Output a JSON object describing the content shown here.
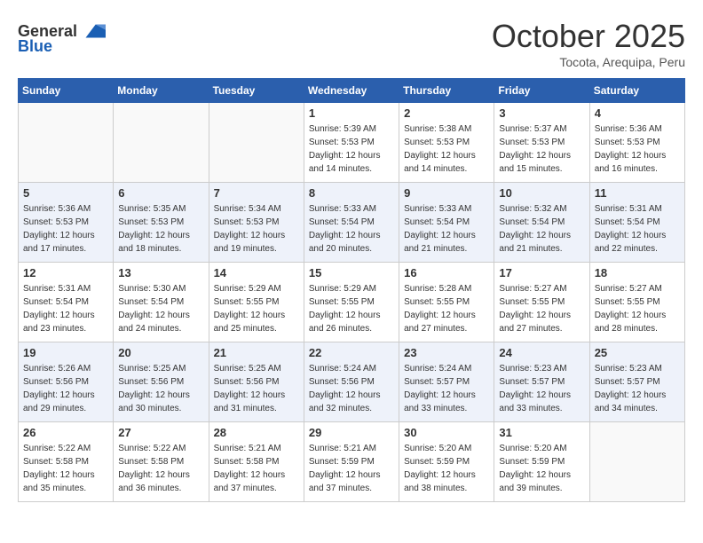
{
  "header": {
    "logo_general": "General",
    "logo_blue": "Blue",
    "month": "October 2025",
    "location": "Tocota, Arequipa, Peru"
  },
  "weekdays": [
    "Sunday",
    "Monday",
    "Tuesday",
    "Wednesday",
    "Thursday",
    "Friday",
    "Saturday"
  ],
  "weeks": [
    [
      {
        "day": "",
        "empty": true
      },
      {
        "day": "",
        "empty": true
      },
      {
        "day": "",
        "empty": true
      },
      {
        "day": "1",
        "sunrise": "5:39 AM",
        "sunset": "5:53 PM",
        "daylight": "12 hours and 14 minutes."
      },
      {
        "day": "2",
        "sunrise": "5:38 AM",
        "sunset": "5:53 PM",
        "daylight": "12 hours and 14 minutes."
      },
      {
        "day": "3",
        "sunrise": "5:37 AM",
        "sunset": "5:53 PM",
        "daylight": "12 hours and 15 minutes."
      },
      {
        "day": "4",
        "sunrise": "5:36 AM",
        "sunset": "5:53 PM",
        "daylight": "12 hours and 16 minutes."
      }
    ],
    [
      {
        "day": "5",
        "sunrise": "5:36 AM",
        "sunset": "5:53 PM",
        "daylight": "12 hours and 17 minutes."
      },
      {
        "day": "6",
        "sunrise": "5:35 AM",
        "sunset": "5:53 PM",
        "daylight": "12 hours and 18 minutes."
      },
      {
        "day": "7",
        "sunrise": "5:34 AM",
        "sunset": "5:53 PM",
        "daylight": "12 hours and 19 minutes."
      },
      {
        "day": "8",
        "sunrise": "5:33 AM",
        "sunset": "5:54 PM",
        "daylight": "12 hours and 20 minutes."
      },
      {
        "day": "9",
        "sunrise": "5:33 AM",
        "sunset": "5:54 PM",
        "daylight": "12 hours and 21 minutes."
      },
      {
        "day": "10",
        "sunrise": "5:32 AM",
        "sunset": "5:54 PM",
        "daylight": "12 hours and 21 minutes."
      },
      {
        "day": "11",
        "sunrise": "5:31 AM",
        "sunset": "5:54 PM",
        "daylight": "12 hours and 22 minutes."
      }
    ],
    [
      {
        "day": "12",
        "sunrise": "5:31 AM",
        "sunset": "5:54 PM",
        "daylight": "12 hours and 23 minutes."
      },
      {
        "day": "13",
        "sunrise": "5:30 AM",
        "sunset": "5:54 PM",
        "daylight": "12 hours and 24 minutes."
      },
      {
        "day": "14",
        "sunrise": "5:29 AM",
        "sunset": "5:55 PM",
        "daylight": "12 hours and 25 minutes."
      },
      {
        "day": "15",
        "sunrise": "5:29 AM",
        "sunset": "5:55 PM",
        "daylight": "12 hours and 26 minutes."
      },
      {
        "day": "16",
        "sunrise": "5:28 AM",
        "sunset": "5:55 PM",
        "daylight": "12 hours and 27 minutes."
      },
      {
        "day": "17",
        "sunrise": "5:27 AM",
        "sunset": "5:55 PM",
        "daylight": "12 hours and 27 minutes."
      },
      {
        "day": "18",
        "sunrise": "5:27 AM",
        "sunset": "5:55 PM",
        "daylight": "12 hours and 28 minutes."
      }
    ],
    [
      {
        "day": "19",
        "sunrise": "5:26 AM",
        "sunset": "5:56 PM",
        "daylight": "12 hours and 29 minutes."
      },
      {
        "day": "20",
        "sunrise": "5:25 AM",
        "sunset": "5:56 PM",
        "daylight": "12 hours and 30 minutes."
      },
      {
        "day": "21",
        "sunrise": "5:25 AM",
        "sunset": "5:56 PM",
        "daylight": "12 hours and 31 minutes."
      },
      {
        "day": "22",
        "sunrise": "5:24 AM",
        "sunset": "5:56 PM",
        "daylight": "12 hours and 32 minutes."
      },
      {
        "day": "23",
        "sunrise": "5:24 AM",
        "sunset": "5:57 PM",
        "daylight": "12 hours and 33 minutes."
      },
      {
        "day": "24",
        "sunrise": "5:23 AM",
        "sunset": "5:57 PM",
        "daylight": "12 hours and 33 minutes."
      },
      {
        "day": "25",
        "sunrise": "5:23 AM",
        "sunset": "5:57 PM",
        "daylight": "12 hours and 34 minutes."
      }
    ],
    [
      {
        "day": "26",
        "sunrise": "5:22 AM",
        "sunset": "5:58 PM",
        "daylight": "12 hours and 35 minutes."
      },
      {
        "day": "27",
        "sunrise": "5:22 AM",
        "sunset": "5:58 PM",
        "daylight": "12 hours and 36 minutes."
      },
      {
        "day": "28",
        "sunrise": "5:21 AM",
        "sunset": "5:58 PM",
        "daylight": "12 hours and 37 minutes."
      },
      {
        "day": "29",
        "sunrise": "5:21 AM",
        "sunset": "5:59 PM",
        "daylight": "12 hours and 37 minutes."
      },
      {
        "day": "30",
        "sunrise": "5:20 AM",
        "sunset": "5:59 PM",
        "daylight": "12 hours and 38 minutes."
      },
      {
        "day": "31",
        "sunrise": "5:20 AM",
        "sunset": "5:59 PM",
        "daylight": "12 hours and 39 minutes."
      },
      {
        "day": "",
        "empty": true
      }
    ]
  ]
}
